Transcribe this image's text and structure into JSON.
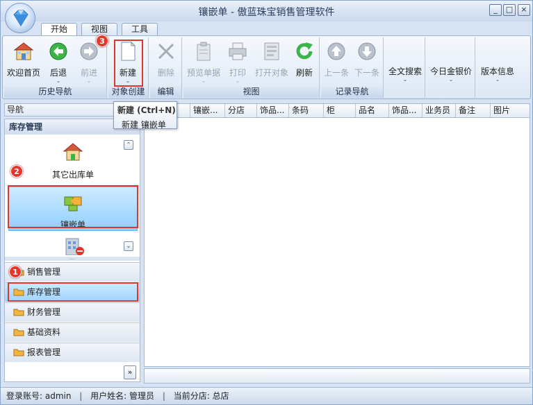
{
  "window": {
    "title": "镶嵌单 - 傲蓝珠宝销售管理软件",
    "controls": [
      "_",
      "□",
      "×"
    ]
  },
  "tabs": [
    {
      "label": "开始",
      "active": true
    },
    {
      "label": "视图"
    },
    {
      "label": "工具"
    }
  ],
  "ribbon": {
    "groups": {
      "history": "历史导航",
      "create": "对象创建",
      "edit": "编辑",
      "view": "视图",
      "record": "记录导航"
    },
    "buttons": {
      "home": "欢迎首页",
      "back": "后退",
      "forward": "前进",
      "new": "新建",
      "delete": "删除",
      "preview": "预览单据",
      "print": "打印",
      "open": "打开对象",
      "refresh": "刷新",
      "prev": "上一条",
      "next": "下一条",
      "search": "全文搜索",
      "gold": "今日金银价",
      "version": "版本信息"
    }
  },
  "tooltip": {
    "title": "新建 (Ctrl+N)",
    "body": "新建 镶嵌单"
  },
  "markers": [
    "1",
    "2",
    "3"
  ],
  "nav": {
    "header": "导航",
    "title": "库存管理",
    "tiles": [
      {
        "label": "其它出库单"
      },
      {
        "label": "镶嵌单",
        "selected": true
      }
    ],
    "categories": [
      {
        "label": "销售管理"
      },
      {
        "label": "库存管理",
        "selected": true
      },
      {
        "label": "财务管理"
      },
      {
        "label": "基础资料"
      },
      {
        "label": "报表管理"
      }
    ],
    "scroll_up": "⌃",
    "scroll_down": "⌄",
    "more": "»",
    "grip": "....."
  },
  "grid": {
    "columns": [
      "",
      "镶嵌...",
      "分店",
      "饰品...",
      "条码",
      "柜",
      "品名",
      "饰品...",
      "业务员",
      "备注",
      "图片"
    ]
  },
  "status": {
    "account_label": "登录账号: admin",
    "user_label": "用户姓名: 管理员",
    "branch_label": "当前分店: 总店",
    "sep": "|"
  },
  "colors": {
    "highlight": "#e0352b",
    "marker": "#e5372c",
    "selected": "#8fd0ff"
  }
}
